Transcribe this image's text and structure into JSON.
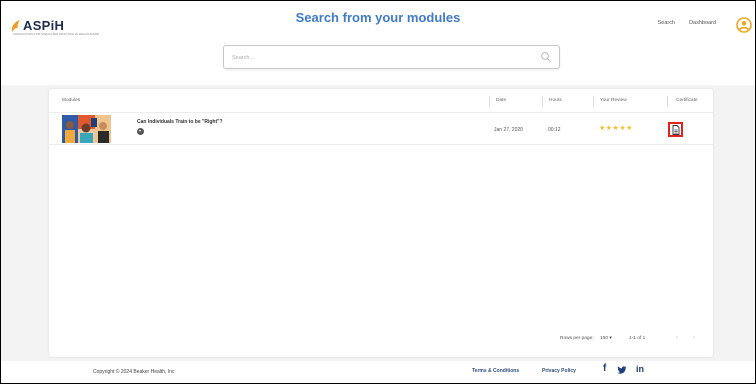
{
  "brand": {
    "name": "ASPiH",
    "tagline": "ASSOCIATION FOR SIMULATED PRACTICE IN HEALTHCARE"
  },
  "header": {
    "title": "Search from your modules",
    "nav_links": [
      "Search",
      "Dashboard"
    ]
  },
  "search": {
    "placeholder": "Search..."
  },
  "table": {
    "columns": [
      "Modules",
      "Date",
      "Hours",
      "Your Review",
      "Certificate"
    ],
    "rows": [
      {
        "title": "Can Individuals Train to be \"Right\"?",
        "date": "Jan 27, 2020",
        "hours": "00:12",
        "rating": 5,
        "stars": "★★★★★"
      }
    ]
  },
  "pagination": {
    "rows_label": "Rows per page:",
    "rows_value": "100",
    "range": "1-1 of 1"
  },
  "footer": {
    "copyright": "Copyright © 2024 Beaker Health, Inc",
    "links": [
      "Terms & Conditions",
      "Privacy Policy"
    ],
    "social": [
      "f",
      "in"
    ]
  },
  "colors": {
    "accent": "#3f7cc8",
    "star": "#f2c12e",
    "highlight": "#e0241b",
    "footer_link": "#2f4f7f"
  },
  "icons": [
    "search-icon",
    "user-icon",
    "document-icon",
    "chevron-down-icon",
    "chevron-left-icon",
    "chevron-right-icon",
    "facebook-icon",
    "twitter-icon",
    "linkedin-icon",
    "play-icon"
  ]
}
